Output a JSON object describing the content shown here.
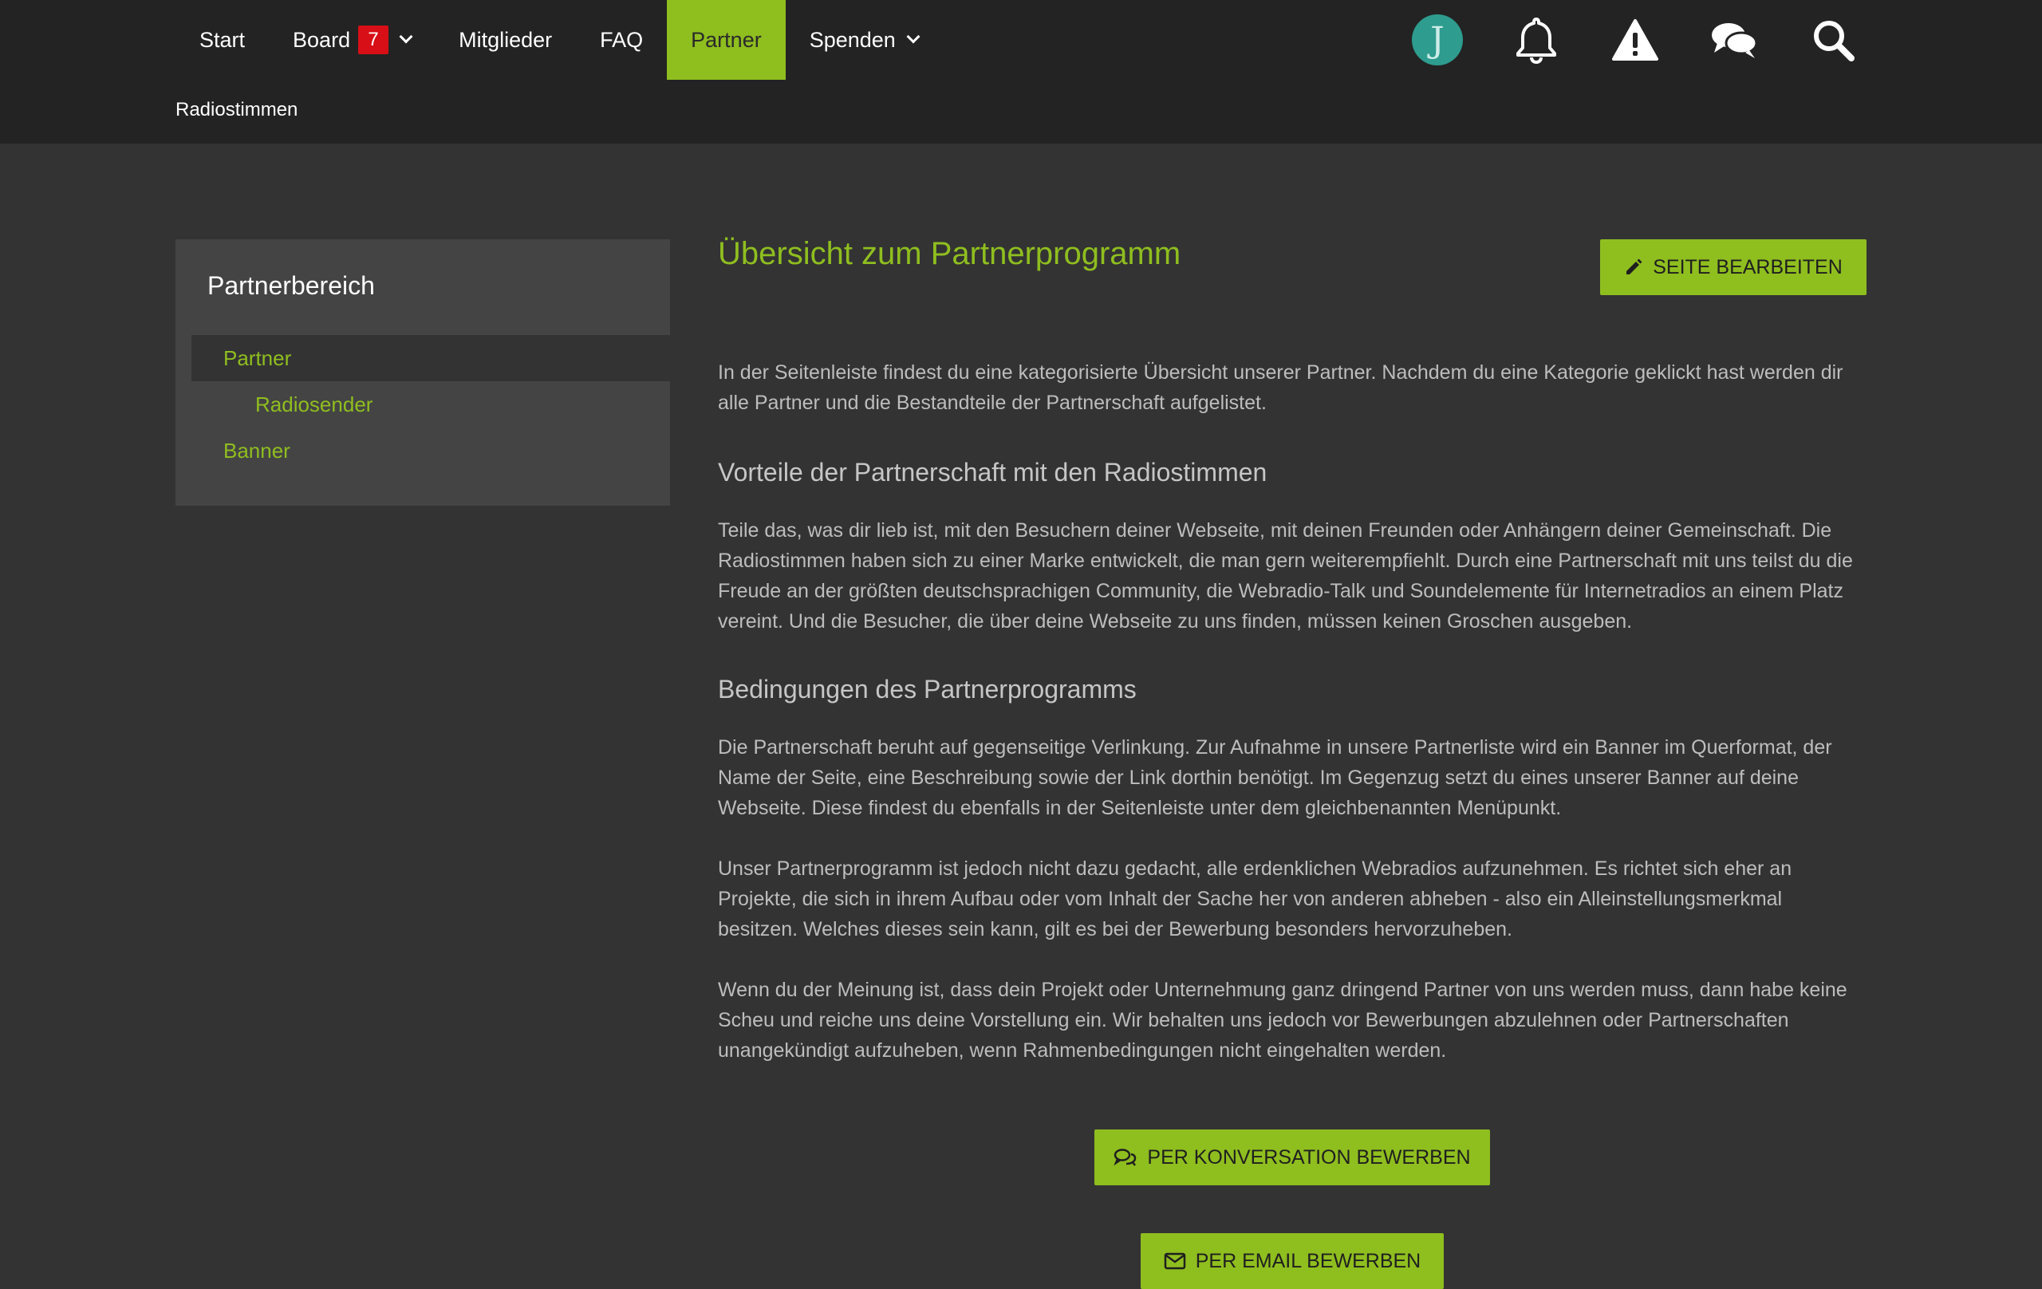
{
  "nav": {
    "items": [
      {
        "label": "Start"
      },
      {
        "label": "Board",
        "badge": "7"
      },
      {
        "label": "Mitglieder"
      },
      {
        "label": "FAQ"
      },
      {
        "label": "Partner"
      },
      {
        "label": "Spenden"
      }
    ],
    "active": "Partner"
  },
  "user": {
    "avatar_initial": "J",
    "icons": [
      "bell-icon",
      "warning-icon",
      "conversations-icon",
      "search-icon"
    ]
  },
  "breadcrumb": "Radiostimmen",
  "sidebar": {
    "title": "Partnerbereich",
    "items": [
      {
        "label": "Partner"
      },
      {
        "label": "Radiosender"
      },
      {
        "label": "Banner"
      }
    ]
  },
  "content": {
    "title": "Übersicht zum Partnerprogramm",
    "edit_button": "SEITE BEARBEITEN",
    "intro": "In der Seitenleiste findest du eine kategorisierte Übersicht unserer Partner. Nachdem du eine Kategorie geklickt hast werden dir alle Partner und die Bestandteile der Partnerschaft aufgelistet.",
    "section1_title": "Vorteile der Partnerschaft mit den Radiostimmen",
    "section1_text": "Teile das, was dir lieb ist, mit den Besuchern deiner Webseite, mit deinen Freunden oder Anhängern deiner Gemeinschaft. Die Radiostimmen haben sich zu einer Marke entwickelt, die man gern weiterempfiehlt. Durch eine Partnerschaft mit uns teilst du die Freude an der größten deutschsprachigen Community, die Webradio-Talk und Soundelemente für Internetradios an einem Platz vereint. Und die Besucher, die über deine Webseite zu uns finden, müssen keinen Groschen ausgeben.",
    "section2_title": "Bedingungen des Partnerprogramms",
    "section2_text1": "Die Partnerschaft beruht auf gegenseitige Verlinkung. Zur Aufnahme in unsere Partnerliste wird ein Banner im Querformat, der Name der Seite, eine Beschreibung sowie der Link dorthin benötigt. Im Gegenzug setzt du eines unserer Banner auf deine Webseite. Diese findest du ebenfalls in der Seitenleiste unter dem gleichbenannten Menüpunkt.",
    "section2_text2": "Unser Partnerprogramm ist jedoch nicht dazu gedacht, alle erdenklichen Webradios aufzunehmen. Es richtet sich eher an Projekte, die sich in ihrem Aufbau oder vom Inhalt der Sache her von anderen abheben - also ein Alleinstellungsmerkmal besitzen. Welches dieses sein kann, gilt es bei der Bewerbung besonders hervorzuheben.",
    "section2_text3": "Wenn du der Meinung ist, dass dein Projekt oder Unternehmung ganz dringend Partner von uns werden muss, dann habe keine Scheu und reiche uns deine Vorstellung ein. Wir behalten uns jedoch vor Bewerbungen abzulehnen oder Partnerschaften unangekündigt aufzuheben, wenn Rahmenbedingungen nicht eingehalten werden.",
    "apply_conversation": "PER KONVERSATION BEWERBEN",
    "apply_email": "PER EMAIL BEWERBEN"
  },
  "colors": {
    "accent": "#8fbe1f",
    "header_bg": "#232323",
    "page_bg": "#333333",
    "sidebar_bg": "#444444",
    "badge": "#d80f16",
    "avatar": "#2e9c8e"
  }
}
